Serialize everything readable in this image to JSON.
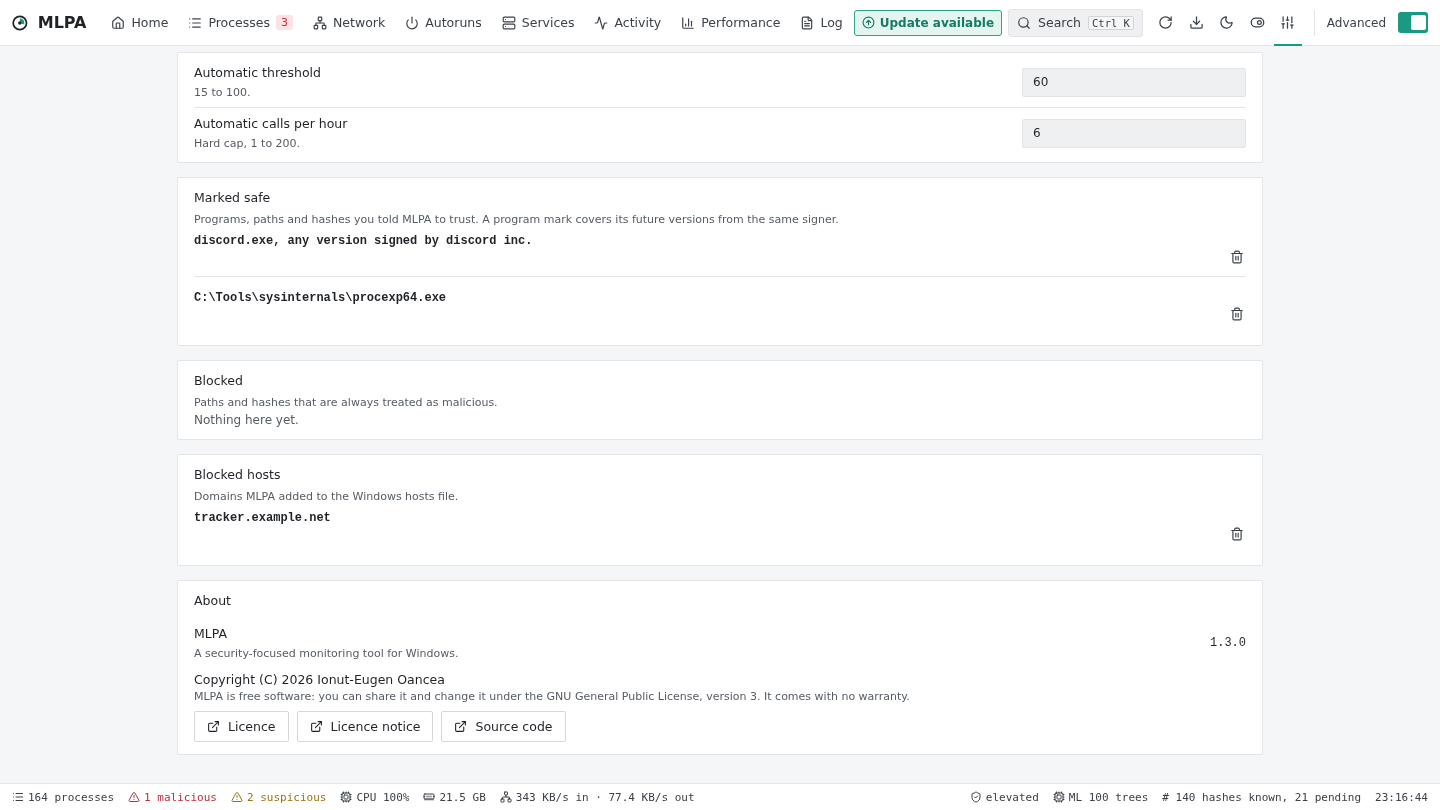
{
  "nav": {
    "brand": "MLPA",
    "items": [
      {
        "label": "Home"
      },
      {
        "label": "Processes",
        "badge": "3"
      },
      {
        "label": "Network"
      },
      {
        "label": "Autoruns"
      },
      {
        "label": "Services"
      },
      {
        "label": "Activity"
      },
      {
        "label": "Performance"
      },
      {
        "label": "Log"
      }
    ],
    "update_button": "Update available",
    "search": {
      "label": "Search",
      "shortcut": "Ctrl K"
    },
    "tools": [
      {
        "selected": false
      },
      {
        "selected": false
      },
      {
        "selected": false
      },
      {
        "selected": false
      },
      {
        "selected": true
      }
    ],
    "advanced": {
      "label": "Advanced",
      "on": true
    }
  },
  "limits": [
    {
      "label": "Automatic threshold",
      "hint": "15 to 100.",
      "value": "60"
    },
    {
      "label": "Automatic calls per hour",
      "hint": "Hard cap, 1 to 200.",
      "value": "6"
    }
  ],
  "marked_safe": {
    "title": "Marked safe",
    "description": "Programs, paths and hashes you told MLPA to trust. A program mark covers its future versions from the same signer.",
    "entries": [
      "discord.exe, any version signed by discord inc.",
      "C:\\Tools\\sysinternals\\procexp64.exe"
    ]
  },
  "blocked": {
    "title": "Blocked",
    "description": "Paths and hashes that are always treated as malicious.",
    "empty": "Nothing here yet."
  },
  "blocked_hosts": {
    "title": "Blocked hosts",
    "description": "Domains MLPA added to the Windows hosts file.",
    "entries": [
      "tracker.example.net"
    ]
  },
  "about": {
    "title": "About",
    "name": "MLPA",
    "tagline": "A security-focused monitoring tool for Windows.",
    "version": "1.3.0",
    "copyright": "Copyright (C) 2026 Ionut-Eugen Oancea",
    "licence": "MLPA is free software: you can share it and change it under the GNU General Public License, version 3. It comes with no warranty.",
    "links": [
      "Licence",
      "Licence notice",
      "Source code"
    ]
  },
  "status_bar": {
    "left": [
      {
        "text": "164 processes",
        "color": "#3b4148"
      },
      {
        "text": "1 malicious",
        "color": "#b8313d"
      },
      {
        "text": "2 suspicious",
        "color": "#9a7410"
      },
      {
        "text": "CPU 100%",
        "color": "#3b4148"
      },
      {
        "text": "21.5 GB",
        "color": "#3b4148"
      },
      {
        "text": "343 KB/s in · 77.4 KB/s out",
        "color": "#3b4148"
      }
    ],
    "right": [
      {
        "text": "elevated"
      },
      {
        "text": "ML 100 trees"
      },
      {
        "text": "# 140 hashes known, 21 pending"
      },
      {
        "text": "23:16:44"
      }
    ]
  }
}
